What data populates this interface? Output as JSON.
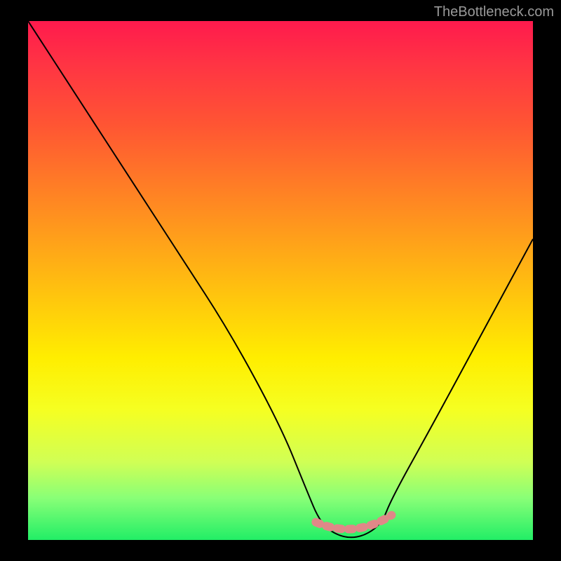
{
  "watermark": "TheBottleneck.com",
  "chart_data": {
    "type": "line",
    "title": "",
    "xlabel": "",
    "ylabel": "",
    "xlim": [
      0,
      100
    ],
    "ylim": [
      0,
      100
    ],
    "series": [
      {
        "name": "curve",
        "x": [
          0,
          10,
          20,
          30,
          40,
          50,
          55,
          58,
          62,
          66,
          70,
          72,
          80,
          90,
          100
        ],
        "y": [
          100,
          85,
          70,
          55,
          40,
          22,
          10,
          3,
          0.5,
          0.5,
          3,
          8,
          22,
          40,
          58
        ]
      }
    ],
    "minimum_band": {
      "x_start": 57,
      "x_end": 72,
      "y": 1,
      "color": "#e08888"
    },
    "gradient_stops": [
      {
        "pos": 0,
        "color": "#ff1a4d"
      },
      {
        "pos": 50,
        "color": "#ffee00"
      },
      {
        "pos": 100,
        "color": "#22ee66"
      }
    ]
  }
}
